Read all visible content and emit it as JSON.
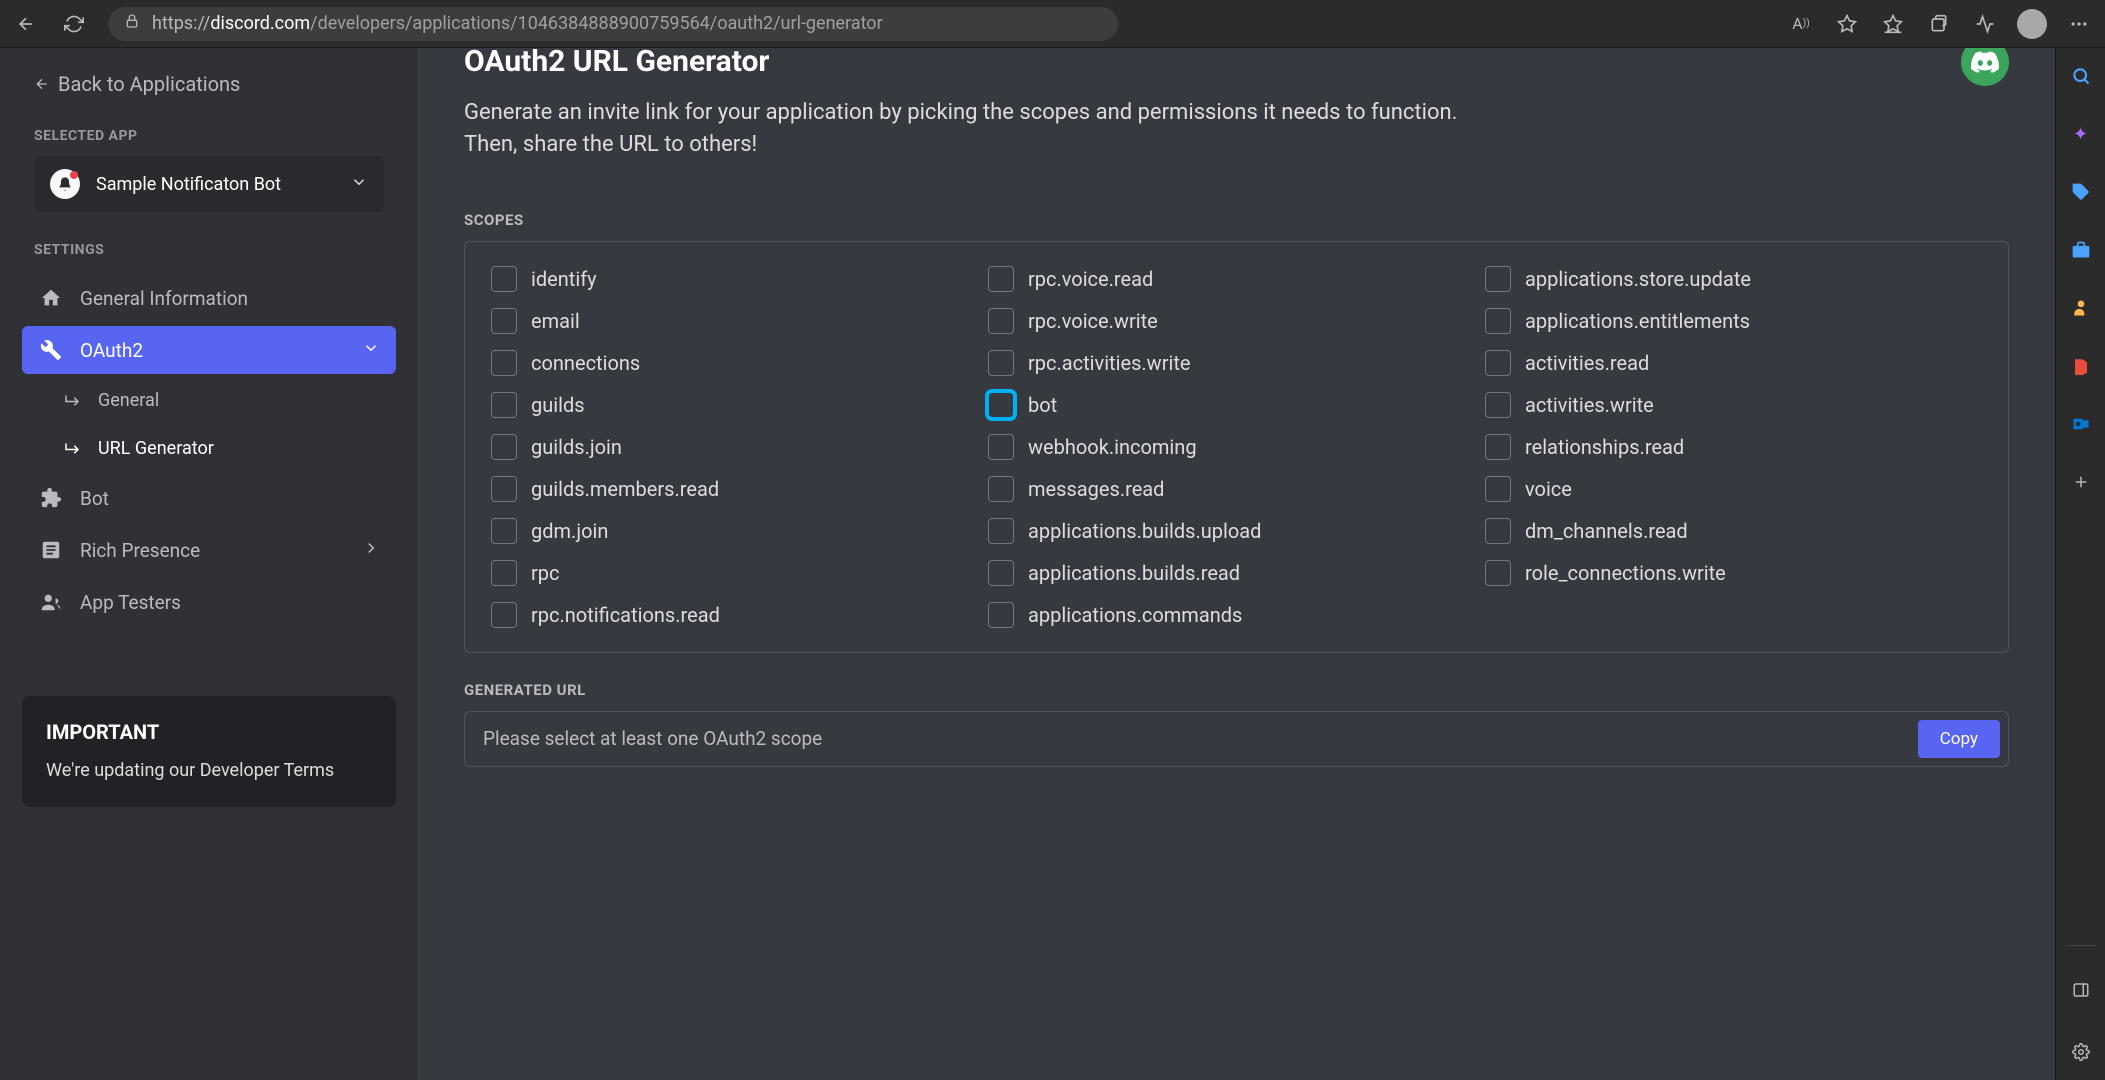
{
  "browser": {
    "url_prefix": "https://",
    "url_domain": "discord.com",
    "url_path": "/developers/applications/1046384888900759564/oauth2/url-generator"
  },
  "sidebar": {
    "back_label": "Back to Applications",
    "selected_app_label": "SELECTED APP",
    "app_name": "Sample Notificaton Bot",
    "settings_label": "SETTINGS",
    "nav": {
      "general_info": "General Information",
      "oauth2": "OAuth2",
      "oauth2_general": "General",
      "oauth2_urlgen": "URL Generator",
      "bot": "Bot",
      "rich_presence": "Rich Presence",
      "app_testers": "App Testers"
    },
    "notice": {
      "title": "IMPORTANT",
      "text": "We're updating our Developer Terms"
    }
  },
  "content": {
    "title": "OAuth2 URL Generator",
    "description": "Generate an invite link for your application by picking the scopes and permissions it needs to function. Then, share the URL to others!",
    "scopes_label": "SCOPES",
    "generated_url_label": "GENERATED URL",
    "generated_url_placeholder": "Please select at least one OAuth2 scope",
    "copy_label": "Copy",
    "scopes": {
      "col1": [
        "identify",
        "email",
        "connections",
        "guilds",
        "guilds.join",
        "guilds.members.read",
        "gdm.join",
        "rpc",
        "rpc.notifications.read"
      ],
      "col2": [
        "rpc.voice.read",
        "rpc.voice.write",
        "rpc.activities.write",
        "bot",
        "webhook.incoming",
        "messages.read",
        "applications.builds.upload",
        "applications.builds.read",
        "applications.commands"
      ],
      "col3": [
        "applications.store.update",
        "applications.entitlements",
        "activities.read",
        "activities.write",
        "relationships.read",
        "voice",
        "dm_channels.read",
        "role_connections.write"
      ]
    },
    "highlighted_scope": "bot"
  }
}
